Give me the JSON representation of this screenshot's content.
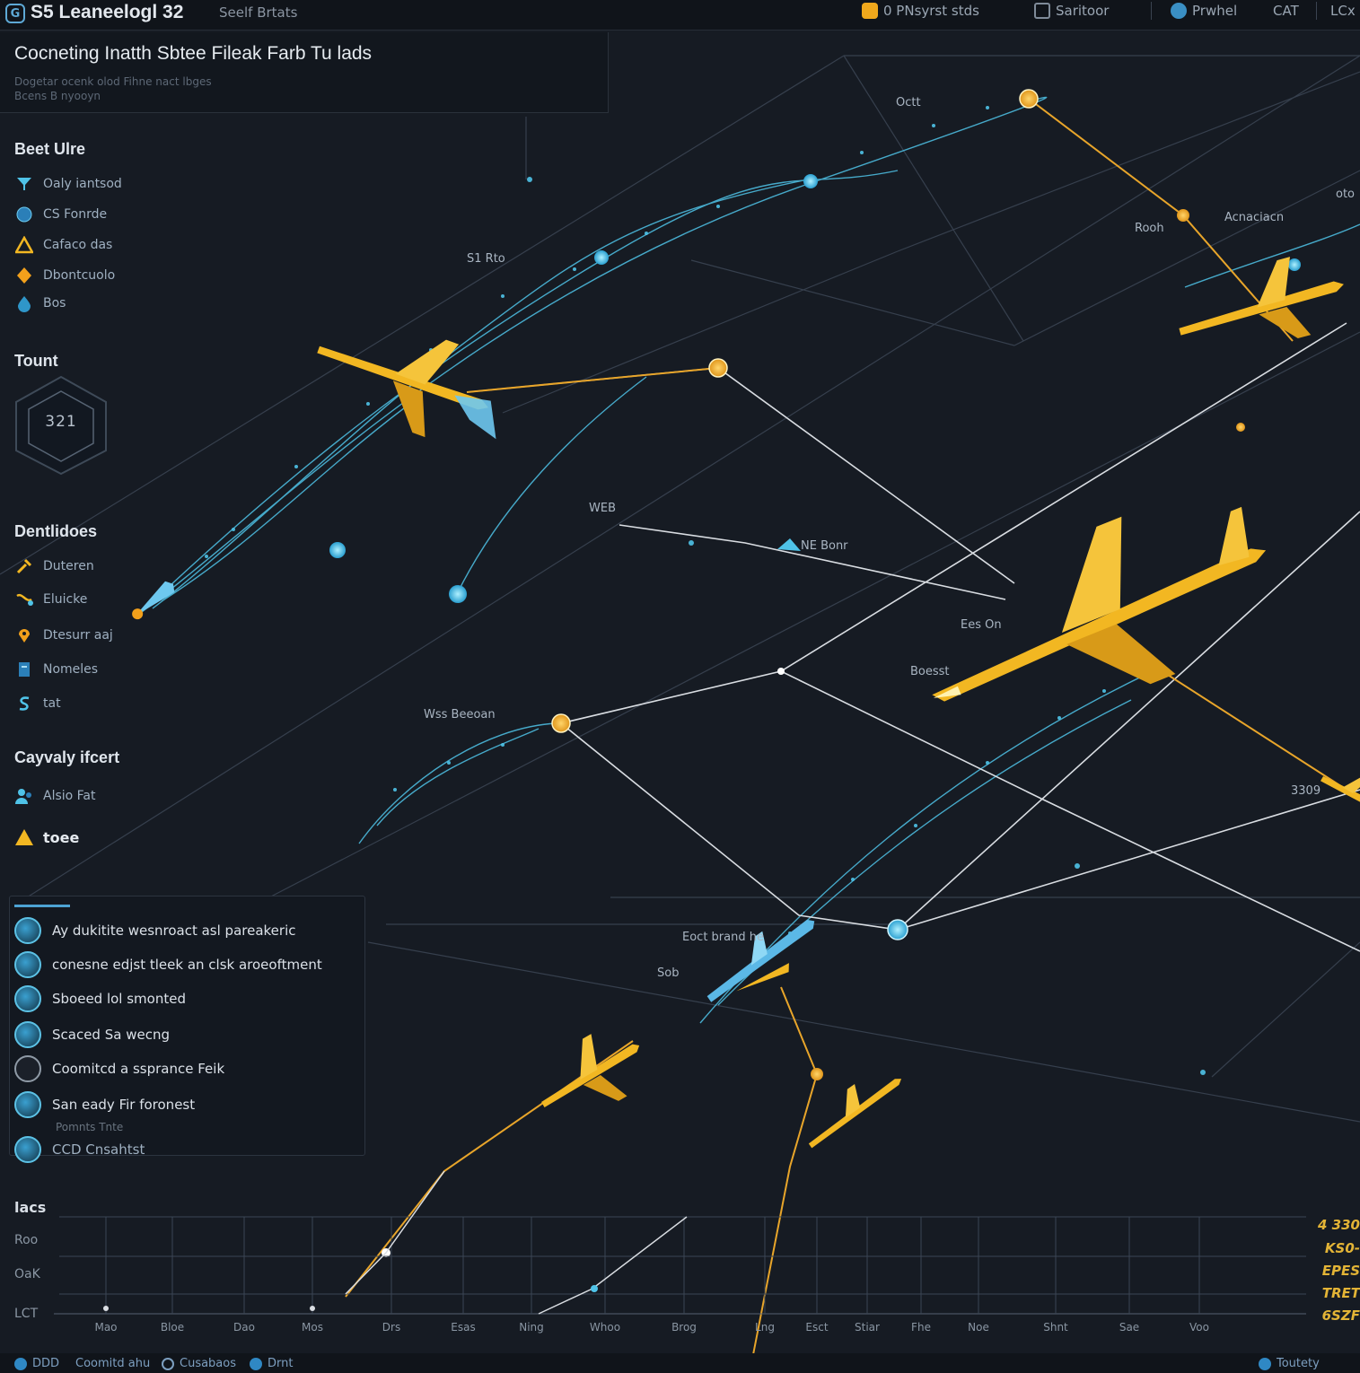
{
  "topbar": {
    "logo_glyph": "G",
    "app_title": "S5 Leaneelogl 32",
    "app_subtitle": "Seelf Brtats",
    "btn_status": "0 PNsyrst stds",
    "btn_settings": "Saritoor",
    "btn_profile": "Prwhel",
    "btn_cat": "CAT",
    "btn_lc": "LCx"
  },
  "title_card": {
    "heading": "Cocneting Inatth Sbtee Fileak Farb Tu lads",
    "subline1": "Dogetar ocenk olod Fihne nact lbges",
    "subline2": "Bcens B nyooyn"
  },
  "sidebar": {
    "legend_title": "Beet Ulre",
    "legend_items": [
      {
        "label": "Oaly iantsod",
        "icon": "funnel-icon"
      },
      {
        "label": "CS Fonrde",
        "icon": "globe-icon"
      },
      {
        "label": "Cafaco das",
        "icon": "triangle-icon"
      },
      {
        "label": "Dbontcuolo",
        "icon": "diamond-icon"
      },
      {
        "label": "Bos",
        "icon": "drop-icon"
      }
    ],
    "count_title": "Tount",
    "count_value": "321",
    "details_title": "Dentlidoes",
    "details_items": [
      {
        "label": "Duteren",
        "icon": "tool-icon"
      },
      {
        "label": "Eluicke",
        "icon": "route-icon"
      },
      {
        "label": "Dtesurr aaj",
        "icon": "pin-icon"
      },
      {
        "label": "Nomeles",
        "icon": "doc-icon"
      },
      {
        "label": "tat",
        "icon": "s-icon"
      }
    ],
    "capacity_title": "Cayvaly ifcert",
    "capacity_items": [
      {
        "label": "Alsio Fat",
        "icon": "people-icon"
      },
      {
        "label": "toee",
        "icon": "warning-icon"
      }
    ]
  },
  "notifications": [
    {
      "text": "Ay dukitite wesnroact asl pareakeric"
    },
    {
      "text": "conesne edjst tleek an clsk aroeoftment"
    },
    {
      "text": "Sboeed lol smonted"
    },
    {
      "text": "Scaced Sa wecng"
    },
    {
      "text": "Coomitcd a ssprance Feik"
    },
    {
      "text": "San eady Fir foronest"
    },
    {
      "text": "CCD Cnsahtst"
    }
  ],
  "notification_subtext": "Pomnts Tnte",
  "map_labels": {
    "l1": "Octt",
    "l2": "S1 Rto",
    "l3": "Rooh",
    "l4": "Acnaciacn",
    "l5": "oto",
    "l6": "WEB",
    "l7": "NE Bonr",
    "l8": "Ees On",
    "l9": "Boesst",
    "l10": "Wss Beeoan",
    "l11": "3309",
    "l12": "Eoct brand he",
    "l13": "Sob"
  },
  "timeline": {
    "title": "lacs",
    "y_labels": [
      "Roo",
      "OaK",
      "LCT"
    ],
    "x_labels": [
      "Mao",
      "Bloe",
      "Dao",
      "Mos",
      "Drs",
      "Esas",
      "Ning",
      "Whoo",
      "Brog",
      "Lng",
      "Esct",
      "Stiar",
      "Fhe",
      "Noe",
      "Shnt",
      "Sae",
      "Voo"
    ],
    "right_labels": [
      "4 330",
      "KS0-",
      "EPES",
      "TRET",
      "6SZF"
    ]
  },
  "bottombar": {
    "item1": "DDD",
    "item2": "Coomitd ahu",
    "item3": "Cusabaos",
    "item4": "Drnt",
    "item5": "Toutety"
  },
  "colors": {
    "background": "#161b23",
    "accent_cyan": "#4fc3e8",
    "accent_yellow": "#f2b722",
    "route_white": "#d9dde2"
  }
}
